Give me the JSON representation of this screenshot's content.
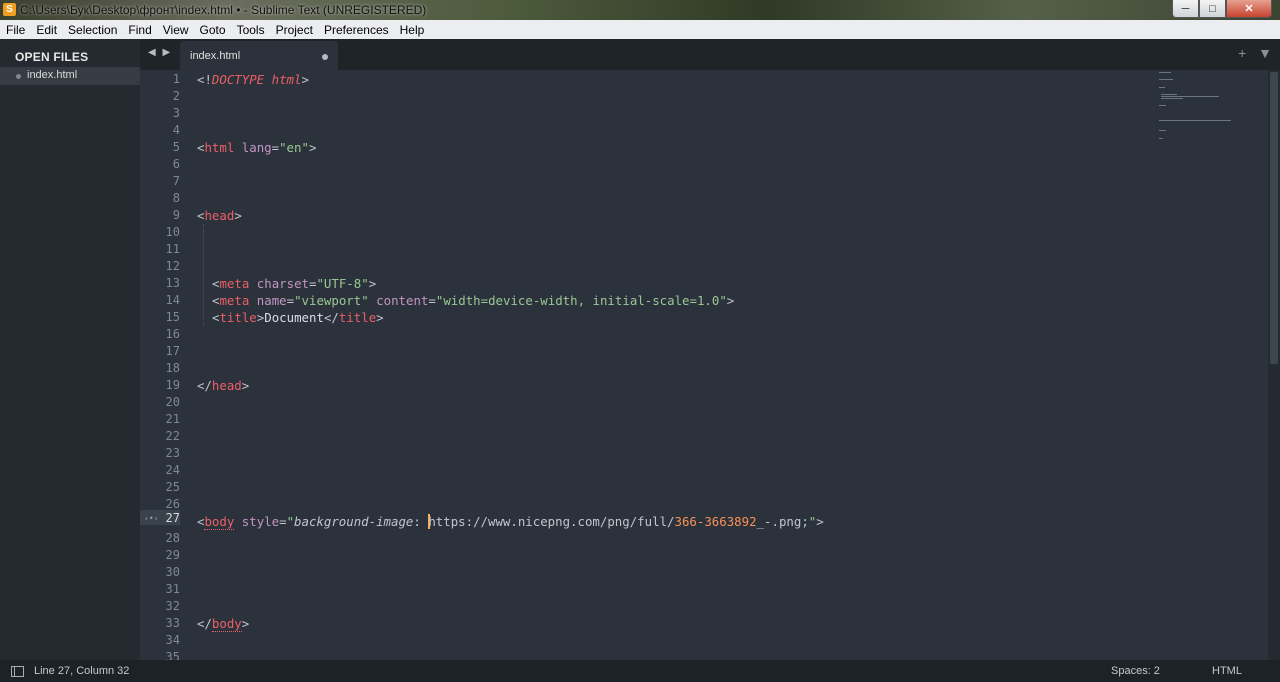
{
  "window": {
    "title": "C:\\Users\\Бук\\Desktop\\фронт\\index.html • - Sublime Text (UNREGISTERED)",
    "controls": {
      "minimize": "─",
      "maximize": "□",
      "close": "✕"
    }
  },
  "menu": [
    "File",
    "Edit",
    "Selection",
    "Find",
    "View",
    "Goto",
    "Tools",
    "Project",
    "Preferences",
    "Help"
  ],
  "sidebar": {
    "header": "OPEN FILES",
    "files": [
      {
        "name": "index.html"
      }
    ]
  },
  "tabs": {
    "nav": "◀ ▶",
    "items": [
      {
        "name": "index.html",
        "modified": true
      }
    ],
    "right_controls": "+ ▼"
  },
  "editor": {
    "line_numbers": [
      "1",
      "2",
      "3",
      "4",
      "5",
      "6",
      "7",
      "8",
      "9",
      "10",
      "11",
      "12",
      "13",
      "14",
      "15",
      "16",
      "17",
      "18",
      "19",
      "20",
      "21",
      "22",
      "23",
      "24",
      "25",
      "26",
      "27",
      "28",
      "29",
      "30",
      "31",
      "32",
      "33",
      "34",
      "35"
    ],
    "active_line": "27",
    "gutter_marker": "‹•›",
    "code": {
      "l1_open": "<!",
      "l1_doctype": "DOCTYPE",
      "l1_html": "html",
      "l1_close": ">",
      "l5_open": "<",
      "l5_tag": "html",
      "l5_attr": "lang",
      "l5_eq": "=",
      "l5_val": "\"en\"",
      "l5_close": ">",
      "l9_open": "<",
      "l9_tag": "head",
      "l9_close": ">",
      "l13_open": "<",
      "l13_tag": "meta",
      "l13_attr": "charset",
      "l13_eq": "=",
      "l13_val": "\"UTF-8\"",
      "l13_close": ">",
      "l14_open": "<",
      "l14_tag": "meta",
      "l14_attr1": "name",
      "l14_eq1": "=",
      "l14_val1": "\"viewport\"",
      "l14_attr2": "content",
      "l14_eq2": "=",
      "l14_val2": "\"width=device-width, initial-scale=1.0\"",
      "l14_close": ">",
      "l15_open": "<",
      "l15_tag": "title",
      "l15_close1": ">",
      "l15_text": "Document",
      "l15_open2": "</",
      "l15_tag2": "title",
      "l15_close2": ">",
      "l19_open": "</",
      "l19_tag": "head",
      "l19_close": ">",
      "l27_open": "<",
      "l27_tag": "body",
      "l27_attr": "style",
      "l27_eq": "=",
      "l27_q1": "\"",
      "l27_prop": "background-image",
      "l27_colon": ": ",
      "l27_url1": "https://www.nicepng.com/png/full/",
      "l27_num": "366-3663892",
      "l27_url2": "_-.png;",
      "l27_q2": "\"",
      "l27_close": ">",
      "l33_open": "</",
      "l33_tag": "body",
      "l33_close": ">"
    }
  },
  "status": {
    "position": "Line 27, Column 32",
    "indent": "Spaces: 2",
    "syntax": "HTML"
  },
  "colors": {
    "editor_bg": "#2b323b",
    "sidebar_bg": "#242a30",
    "tag": "#ec5f67",
    "attribute": "#c594c5",
    "string": "#99c794",
    "number": "#f99157",
    "caret": "#f9ae58"
  }
}
